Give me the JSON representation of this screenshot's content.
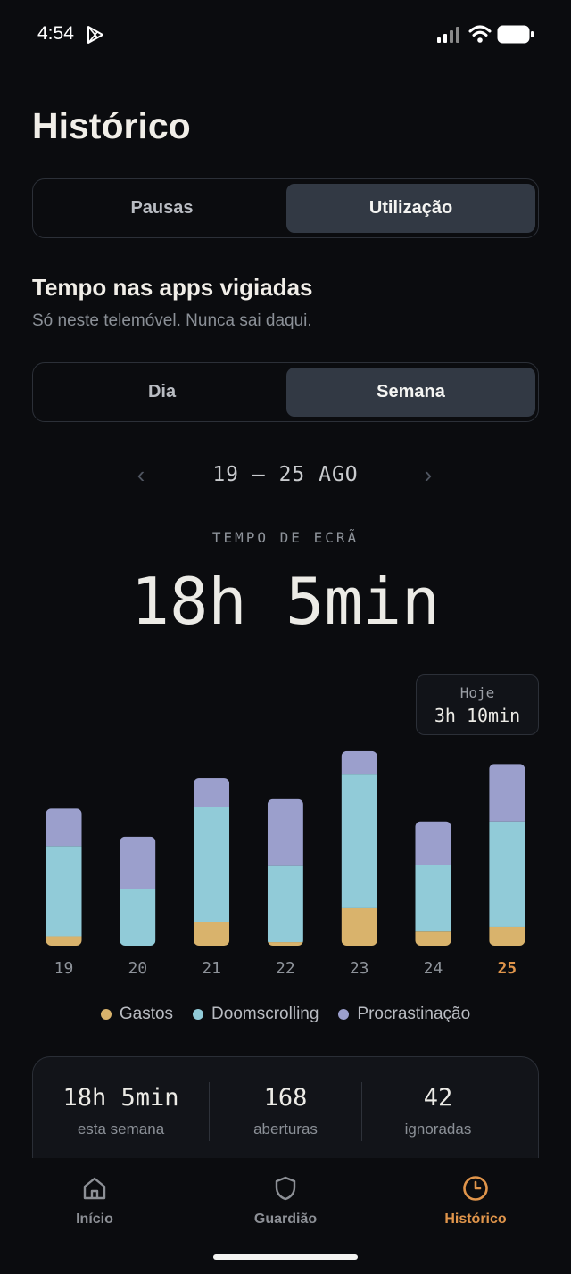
{
  "status_bar": {
    "time": "4:54",
    "icons": [
      "play-store-icon",
      "signal-icon",
      "wifi-icon",
      "battery-icon"
    ]
  },
  "page": {
    "title": "Histórico"
  },
  "top_tabs": {
    "left": "Pausas",
    "right": "Utilização",
    "active": "right"
  },
  "section": {
    "title": "Tempo nas apps vigiadas",
    "subtitle": "Só neste telemóvel. Nunca sai daqui."
  },
  "period_tabs": {
    "left": "Dia",
    "right": "Semana",
    "active": "right"
  },
  "week_nav": {
    "prev": "‹",
    "range": "19 – 25 AGO",
    "next": "›"
  },
  "screen_time": {
    "label": "TEMPO DE ECRÃ",
    "value": "18h 5min"
  },
  "tooltip": {
    "label": "Hoje",
    "value": "3h 10min"
  },
  "colors": {
    "gastos": "#d9b36c",
    "doomscrolling": "#91cbd8",
    "procrastinacao": "#9b9fcc",
    "accent": "#e0954b"
  },
  "chart_data": {
    "type": "bar",
    "stacked": true,
    "categories": [
      "19",
      "20",
      "21",
      "22",
      "23",
      "24",
      "25"
    ],
    "highlight_category": "25",
    "unit": "min",
    "series": [
      {
        "name": "Gastos",
        "values": [
          8,
          0,
          20,
          3,
          32,
          12,
          16
        ]
      },
      {
        "name": "Doomscrolling",
        "values": [
          77,
          48,
          98,
          65,
          114,
          57,
          90
        ]
      },
      {
        "name": "Procrastinação",
        "values": [
          32,
          45,
          25,
          57,
          20,
          37,
          49
        ]
      }
    ],
    "ylim": [
      0,
      175
    ],
    "grid": false,
    "legend_position": "bottom"
  },
  "legend": {
    "gastos": "Gastos",
    "doomscrolling": "Doomscrolling",
    "procrastinacao": "Procrastinação"
  },
  "stats": [
    {
      "value": "18h 5min",
      "label": "esta semana"
    },
    {
      "value": "168",
      "label": "aberturas"
    },
    {
      "value": "42",
      "label": "ignoradas"
    }
  ],
  "bottom_nav": {
    "items": [
      {
        "label": "Início",
        "icon": "home-icon"
      },
      {
        "label": "Guardião",
        "icon": "shield-icon"
      },
      {
        "label": "Histórico",
        "icon": "clock-icon"
      }
    ],
    "active_index": 2
  }
}
